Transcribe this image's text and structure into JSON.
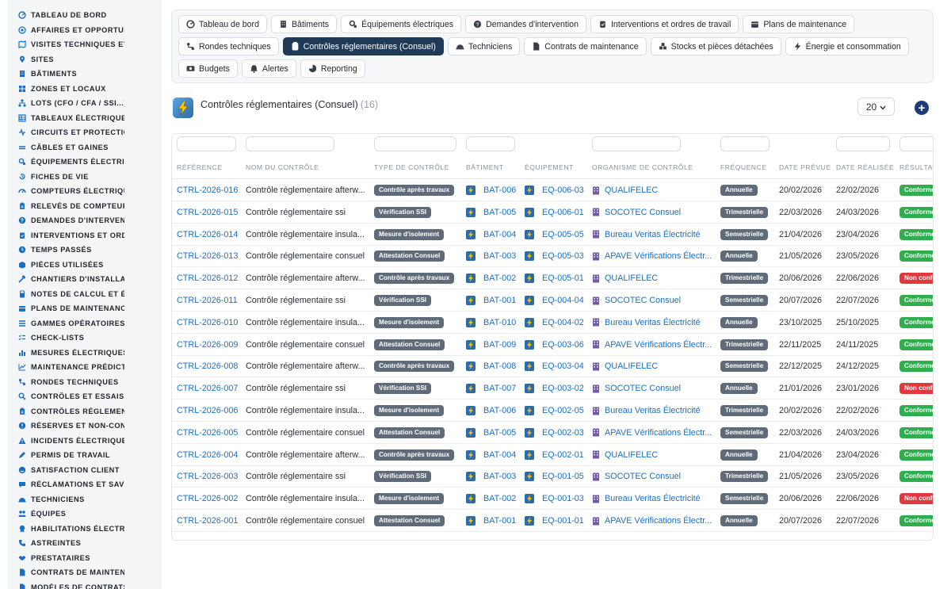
{
  "sidebar": {
    "items": [
      {
        "label": "TABLEAU DE BORD",
        "icon": "dashboard-icon"
      },
      {
        "label": "AFFAIRES ET OPPORTUNITÉS",
        "icon": "target-icon"
      },
      {
        "label": "VISITES TECHNIQUES ET",
        "icon": "map-icon"
      },
      {
        "label": "SITES",
        "icon": "pin-icon"
      },
      {
        "label": "BÂTIMENTS",
        "icon": "building-icon"
      },
      {
        "label": "ZONES ET LOCAUX",
        "icon": "grid-icon"
      },
      {
        "label": "LOTS (CFO / CFA / SSI...)",
        "icon": "sitemap-icon"
      },
      {
        "label": "TABLEAUX ÉLECTRIQUES",
        "icon": "table-icon"
      },
      {
        "label": "CIRCUITS ET PROTECTIONS",
        "icon": "circuit-icon"
      },
      {
        "label": "CÂBLES ET GAINES",
        "icon": "cable-icon"
      },
      {
        "label": "ÉQUIPEMENTS ÉLECTRIQUES",
        "icon": "gears-icon"
      },
      {
        "label": "FICHES DE VIE",
        "icon": "history-icon"
      },
      {
        "label": "COMPTEURS ÉLECTRIQUES",
        "icon": "gauge-icon"
      },
      {
        "label": "RELEVÉS DE COMPTEURS",
        "icon": "clipboard-icon"
      },
      {
        "label": "DEMANDES D'INTERVENTION",
        "icon": "question-icon"
      },
      {
        "label": "INTERVENTIONS ET ORDRES",
        "icon": "clipboard-check-icon"
      },
      {
        "label": "TEMPS PASSÉS",
        "icon": "clock-icon"
      },
      {
        "label": "PIÈCES UTILISÉES",
        "icon": "box-icon"
      },
      {
        "label": "CHANTIERS D'INSTALLATION",
        "icon": "hammer-icon"
      },
      {
        "label": "NOTES DE CALCUL ET ÉTUDES",
        "icon": "calculator-icon"
      },
      {
        "label": "PLANS DE MAINTENANCE",
        "icon": "calendar-icon"
      },
      {
        "label": "GAMMES OPÉRATOIRES",
        "icon": "list-icon"
      },
      {
        "label": "CHECK-LISTS",
        "icon": "checklist-icon"
      },
      {
        "label": "MESURES ÉLECTRIQUES",
        "icon": "chart-icon"
      },
      {
        "label": "MAINTENANCE PRÉDICTIVE",
        "icon": "line-chart-icon"
      },
      {
        "label": "RONDES TECHNIQUES",
        "icon": "route-icon"
      },
      {
        "label": "CONTRÔLES ET ESSAIS",
        "icon": "search-icon"
      },
      {
        "label": "CONTRÔLES RÉGLEMENTAIRES",
        "icon": "clipboard-icon"
      },
      {
        "label": "RÉSERVES ET NON-CONFORMITÉS",
        "icon": "alert-circle-icon"
      },
      {
        "label": "INCIDENTS ÉLECTRIQUES",
        "icon": "warning-icon"
      },
      {
        "label": "PERMIS DE TRAVAIL",
        "icon": "pen-icon"
      },
      {
        "label": "SATISFACTION CLIENT",
        "icon": "smile-icon"
      },
      {
        "label": "RÉCLAMATIONS ET SAV",
        "icon": "comment-icon"
      },
      {
        "label": "TECHNICIENS",
        "icon": "helmet-icon"
      },
      {
        "label": "ÉQUIPES",
        "icon": "users-icon"
      },
      {
        "label": "HABILITATIONS ÉLECTRIQUES",
        "icon": "badge-icon"
      },
      {
        "label": "ASTREINTES",
        "icon": "phone-icon"
      },
      {
        "label": "PRESTATAIRES",
        "icon": "handshake-icon"
      },
      {
        "label": "CONTRATS DE MAINTENANCE",
        "icon": "file-icon"
      },
      {
        "label": "MODÈLES DE CONTRATS",
        "icon": "file-icon"
      }
    ]
  },
  "tabs": [
    {
      "label": "Tableau de bord",
      "icon": "dashboard-icon"
    },
    {
      "label": "Bâtiments",
      "icon": "building-icon"
    },
    {
      "label": "Équipements électriques",
      "icon": "gears-icon"
    },
    {
      "label": "Demandes d'intervention",
      "icon": "question-icon"
    },
    {
      "label": "Interventions et ordres de travail",
      "icon": "clipboard-check-icon"
    },
    {
      "label": "Plans de maintenance",
      "icon": "calendar-icon"
    },
    {
      "label": "Rondes techniques",
      "icon": "route-icon"
    },
    {
      "label": "Contrôles réglementaires (Consuel)",
      "icon": "clipboard-icon",
      "active": true
    },
    {
      "label": "Techniciens",
      "icon": "helmet-icon"
    },
    {
      "label": "Contrats de maintenance",
      "icon": "file-icon"
    },
    {
      "label": "Stocks et pièces détachées",
      "icon": "boxes-icon"
    },
    {
      "label": "Énergie et consommation",
      "icon": "bolt-icon"
    },
    {
      "label": "Budgets",
      "icon": "money-icon"
    },
    {
      "label": "Alertes",
      "icon": "bell-icon"
    },
    {
      "label": "Reporting",
      "icon": "pie-icon"
    }
  ],
  "page": {
    "title": "Contrôles réglementaires (Consuel)",
    "count": "(16)",
    "page_size": "20"
  },
  "colors": {
    "accent": "#1f3a57",
    "link": "#1c6fc0",
    "ok": "#2fae4e",
    "nok": "#e0383e",
    "badge": "#5f6b78"
  },
  "table": {
    "columns": [
      "RÉFÉRENCE",
      "NOM DU CONTRÔLE",
      "TYPE DE CONTRÔLE",
      "BÂTIMENT",
      "ÉQUIPEMENT",
      "ORGANISME DE CONTRÔLE",
      "FRÉQUENCE",
      "DATE PRÉVUE",
      "DATE RÉALISÉE",
      "RÉSULTAT"
    ],
    "rows": [
      {
        "ref": "CTRL-2026-016",
        "nom": "Contrôle réglementaire afterw...",
        "type": "Contrôle après travaux",
        "bat": "BAT-006",
        "eq": "EQ-006-03",
        "org": "QUALIFELEC",
        "freq": "Annuelle",
        "prevue": "20/02/2026",
        "realisee": "22/02/2026",
        "result": "Conforme",
        "ok": true
      },
      {
        "ref": "CTRL-2026-015",
        "nom": "Contrôle réglementaire ssi",
        "type": "Vérification SSI",
        "bat": "BAT-005",
        "eq": "EQ-006-01",
        "org": "SOCOTEC Consuel",
        "freq": "Trimestrielle",
        "prevue": "22/03/2026",
        "realisee": "24/03/2026",
        "result": "Conforme",
        "ok": true
      },
      {
        "ref": "CTRL-2026-014",
        "nom": "Contrôle réglementaire insula...",
        "type": "Mesure d'isolement",
        "bat": "BAT-004",
        "eq": "EQ-005-05",
        "org": "Bureau Veritas Électricité",
        "freq": "Semestrielle",
        "prevue": "21/04/2026",
        "realisee": "23/04/2026",
        "result": "Conforme",
        "ok": true
      },
      {
        "ref": "CTRL-2026-013",
        "nom": "Contrôle réglementaire consuel",
        "type": "Attestation Consuel",
        "bat": "BAT-003",
        "eq": "EQ-005-03",
        "org": "APAVE Vérifications Électr...",
        "freq": "Annuelle",
        "prevue": "21/05/2026",
        "realisee": "23/05/2026",
        "result": "Conforme",
        "ok": true
      },
      {
        "ref": "CTRL-2026-012",
        "nom": "Contrôle réglementaire afterw...",
        "type": "Contrôle après travaux",
        "bat": "BAT-002",
        "eq": "EQ-005-01",
        "org": "QUALIFELEC",
        "freq": "Trimestrielle",
        "prevue": "20/06/2026",
        "realisee": "22/06/2026",
        "result": "Non conforme",
        "ok": false
      },
      {
        "ref": "CTRL-2026-011",
        "nom": "Contrôle réglementaire ssi",
        "type": "Vérification SSI",
        "bat": "BAT-001",
        "eq": "EQ-004-04",
        "org": "SOCOTEC Consuel",
        "freq": "Semestrielle",
        "prevue": "20/07/2026",
        "realisee": "22/07/2026",
        "result": "Conforme",
        "ok": true
      },
      {
        "ref": "CTRL-2026-010",
        "nom": "Contrôle réglementaire insula...",
        "type": "Mesure d'isolement",
        "bat": "BAT-010",
        "eq": "EQ-004-02",
        "org": "Bureau Veritas Électricité",
        "freq": "Annuelle",
        "prevue": "23/10/2025",
        "realisee": "25/10/2025",
        "result": "Conforme",
        "ok": true
      },
      {
        "ref": "CTRL-2026-009",
        "nom": "Contrôle réglementaire consuel",
        "type": "Attestation Consuel",
        "bat": "BAT-009",
        "eq": "EQ-003-06",
        "org": "APAVE Vérifications Électr...",
        "freq": "Trimestrielle",
        "prevue": "22/11/2025",
        "realisee": "24/11/2025",
        "result": "Conforme",
        "ok": true
      },
      {
        "ref": "CTRL-2026-008",
        "nom": "Contrôle réglementaire afterw...",
        "type": "Contrôle après travaux",
        "bat": "BAT-008",
        "eq": "EQ-003-04",
        "org": "QUALIFELEC",
        "freq": "Semestrielle",
        "prevue": "22/12/2025",
        "realisee": "24/12/2025",
        "result": "Conforme",
        "ok": true
      },
      {
        "ref": "CTRL-2026-007",
        "nom": "Contrôle réglementaire ssi",
        "type": "Vérification SSI",
        "bat": "BAT-007",
        "eq": "EQ-003-02",
        "org": "SOCOTEC Consuel",
        "freq": "Annuelle",
        "prevue": "21/01/2026",
        "realisee": "23/01/2026",
        "result": "Non conforme",
        "ok": false
      },
      {
        "ref": "CTRL-2026-006",
        "nom": "Contrôle réglementaire insula...",
        "type": "Mesure d'isolement",
        "bat": "BAT-006",
        "eq": "EQ-002-05",
        "org": "Bureau Veritas Électricité",
        "freq": "Trimestrielle",
        "prevue": "20/02/2026",
        "realisee": "22/02/2026",
        "result": "Conforme",
        "ok": true
      },
      {
        "ref": "CTRL-2026-005",
        "nom": "Contrôle réglementaire consuel",
        "type": "Attestation Consuel",
        "bat": "BAT-005",
        "eq": "EQ-002-03",
        "org": "APAVE Vérifications Électr...",
        "freq": "Semestrielle",
        "prevue": "22/03/2026",
        "realisee": "24/03/2026",
        "result": "Conforme",
        "ok": true
      },
      {
        "ref": "CTRL-2026-004",
        "nom": "Contrôle réglementaire afterw...",
        "type": "Contrôle après travaux",
        "bat": "BAT-004",
        "eq": "EQ-002-01",
        "org": "QUALIFELEC",
        "freq": "Annuelle",
        "prevue": "21/04/2026",
        "realisee": "23/04/2026",
        "result": "Conforme",
        "ok": true
      },
      {
        "ref": "CTRL-2026-003",
        "nom": "Contrôle réglementaire ssi",
        "type": "Vérification SSI",
        "bat": "BAT-003",
        "eq": "EQ-001-05",
        "org": "SOCOTEC Consuel",
        "freq": "Trimestrielle",
        "prevue": "21/05/2026",
        "realisee": "23/05/2026",
        "result": "Conforme",
        "ok": true
      },
      {
        "ref": "CTRL-2026-002",
        "nom": "Contrôle réglementaire insula...",
        "type": "Mesure d'isolement",
        "bat": "BAT-002",
        "eq": "EQ-001-03",
        "org": "Bureau Veritas Électricité",
        "freq": "Semestrielle",
        "prevue": "20/06/2026",
        "realisee": "22/06/2026",
        "result": "Non conforme",
        "ok": false
      },
      {
        "ref": "CTRL-2026-001",
        "nom": "Contrôle réglementaire consuel",
        "type": "Attestation Consuel",
        "bat": "BAT-001",
        "eq": "EQ-001-01",
        "org": "APAVE Vérifications Électr...",
        "freq": "Annuelle",
        "prevue": "20/07/2026",
        "realisee": "22/07/2026",
        "result": "Conforme",
        "ok": true
      }
    ]
  }
}
